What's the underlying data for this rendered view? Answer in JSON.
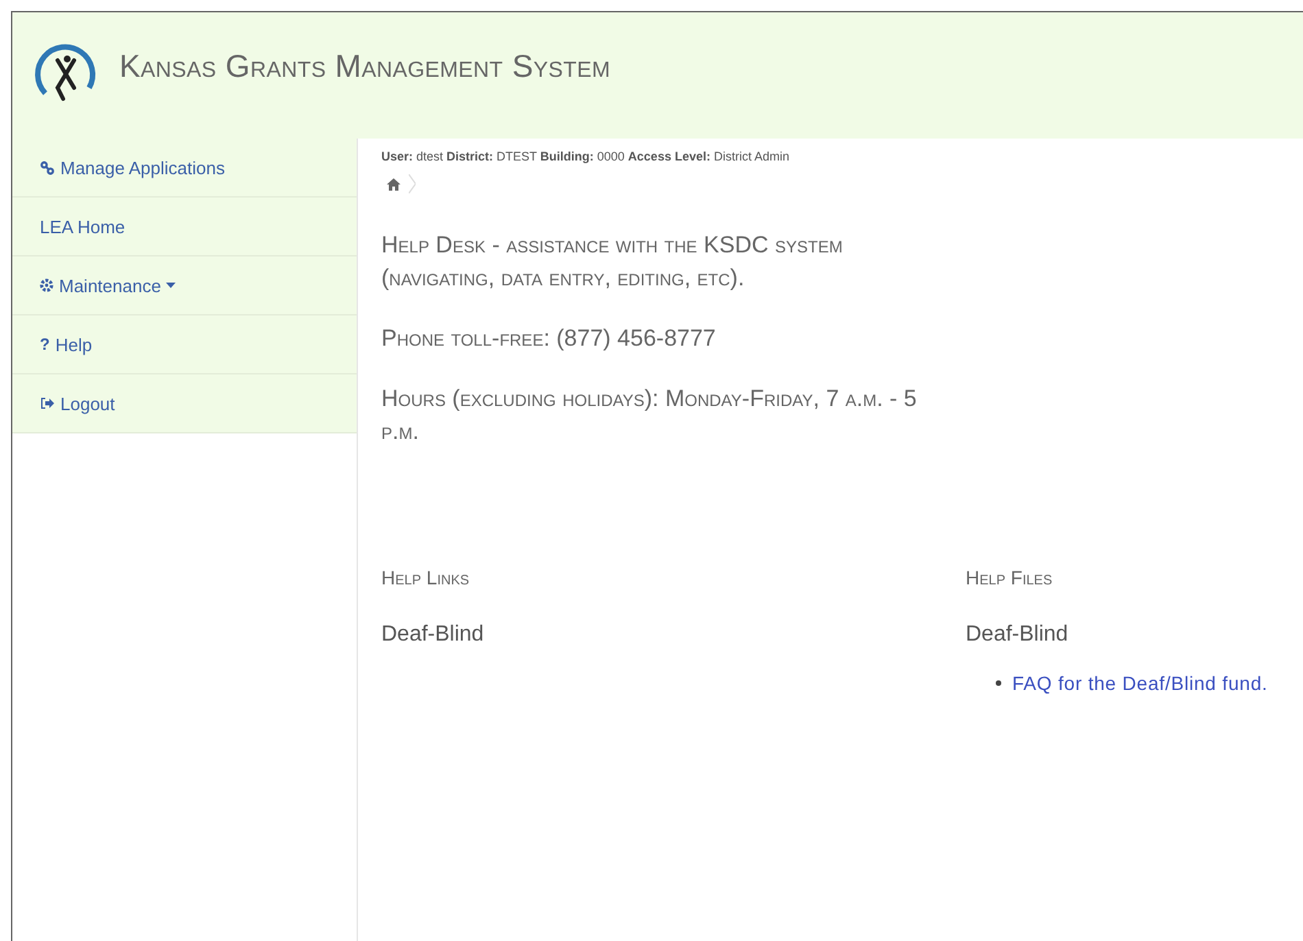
{
  "header": {
    "title": "Kansas Grants Management System"
  },
  "sidebar": {
    "items": [
      {
        "label": "Manage Applications",
        "kind": "link",
        "dropdown": false
      },
      {
        "label": "LEA Home",
        "kind": "plain",
        "dropdown": false
      },
      {
        "label": "Maintenance",
        "kind": "gear",
        "dropdown": true
      },
      {
        "label": "Help",
        "kind": "glyph",
        "glyph": "?",
        "dropdown": false
      },
      {
        "label": "Logout",
        "kind": "logout",
        "dropdown": false
      }
    ]
  },
  "user_info": "**User:** dtest **District:** DTEST **Building:** 0000 **Access Level:** District Admin",
  "help_desk": [
    "Help Desk - assistance with the KSDC system (navigating, data entry, editing, etc).",
    "Phone toll-free: (877) 456-8777",
    "Hours (excluding holidays): Monday-Friday, 7 a.m. - 5 p.m."
  ],
  "help_links": {
    "title": "Help Links",
    "groups": [
      {
        "name": "Deaf-Blind"
      }
    ]
  },
  "help_files": {
    "title": "Help Files",
    "groups": [
      {
        "name": "Deaf-Blind",
        "links": [
          "FAQ for the Deaf/Blind fund."
        ]
      }
    ]
  }
}
